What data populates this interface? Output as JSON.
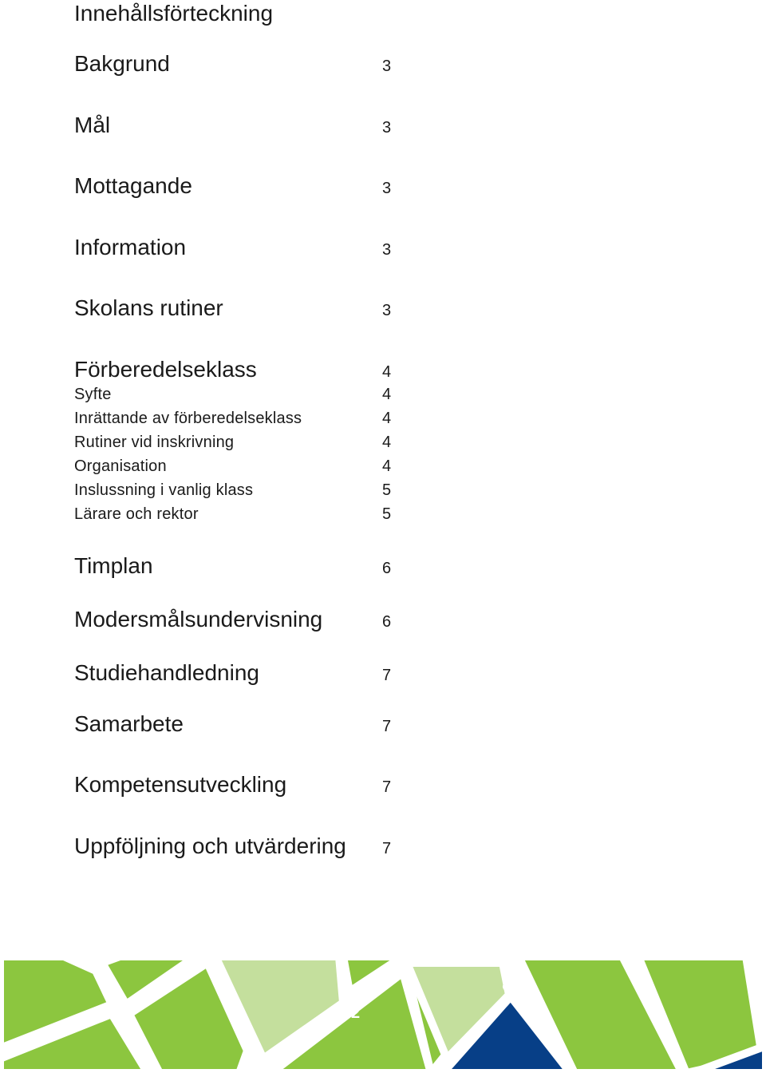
{
  "toc": {
    "title": "Innehållsförteckning",
    "entries": [
      {
        "label": "Bakgrund",
        "page": "3",
        "level": "major"
      },
      {
        "label": "Mål",
        "page": "3",
        "level": "major"
      },
      {
        "label": "Mottagande",
        "page": "3",
        "level": "major"
      },
      {
        "label": "Information",
        "page": "3",
        "level": "major"
      },
      {
        "label": "Skolans rutiner",
        "page": "3",
        "level": "major"
      },
      {
        "label": "Förberedelseklass",
        "page": "4",
        "level": "major"
      },
      {
        "label": "Syfte",
        "page": "4",
        "level": "minor"
      },
      {
        "label": "Inrättande av förberedelseklass",
        "page": "4",
        "level": "minor"
      },
      {
        "label": "Rutiner vid inskrivning",
        "page": "4",
        "level": "minor"
      },
      {
        "label": "Organisation",
        "page": "4",
        "level": "minor"
      },
      {
        "label": "Inslussning i vanlig klass",
        "page": "5",
        "level": "minor"
      },
      {
        "label": "Lärare och rektor",
        "page": "5",
        "level": "minor"
      },
      {
        "label": "Timplan",
        "page": "6",
        "level": "major"
      },
      {
        "label": "Modersmålsundervisning",
        "page": "6",
        "level": "major"
      },
      {
        "label": "Studiehandledning",
        "page": "7",
        "level": "major"
      },
      {
        "label": "Samarbete",
        "page": "7",
        "level": "major"
      },
      {
        "label": "Kompetensutveckling",
        "page": "7",
        "level": "major"
      },
      {
        "label": "Uppföljning och utvärdering",
        "page": "7",
        "level": "major"
      }
    ]
  },
  "footer": {
    "page_number": "2",
    "colors": {
      "green": "#8cc63f",
      "light_green": "#c4df9d",
      "blue": "#073f87"
    }
  }
}
